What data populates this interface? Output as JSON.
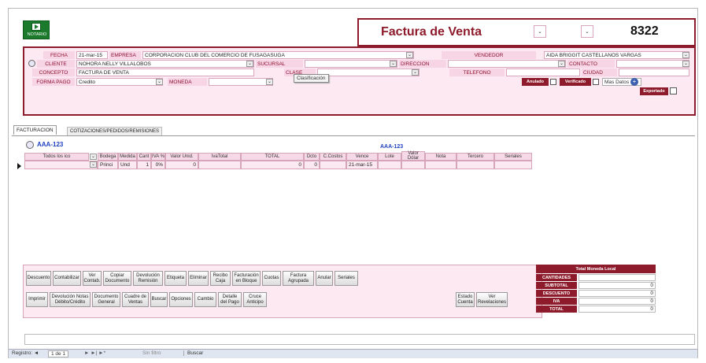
{
  "logo": {
    "label": "NOTARIO"
  },
  "header": {
    "title": "Factura de Venta",
    "number": "8322"
  },
  "fields": {
    "fecha_label": "FECHA",
    "fecha": "21-mar-15",
    "empresa_label": "EMPRESA",
    "empresa": "CORPORACION CLUB DEL COMERCIO DE FUSAGASUGA",
    "vendedor_label": "VENDEDOR",
    "vendedor": "AIDA BRIGGIT CASTELLANOS VARGAS",
    "cliente_label": "CLIENTE",
    "cliente": "NOHORA NELLY VILLALOBOS",
    "sucursal_label": "SUCURSAL",
    "direccion_label": "DIRECCION",
    "contacto_label": "CONTACTO",
    "concepto_label": "CONCEPTO",
    "concepto": "FACTURA DE VENTA",
    "clase_label": "CLASE",
    "telefono_label": "TELEFONO",
    "ciudad_label": "CIUDAD",
    "clasificacion_tooltip": "Clasificación",
    "forma_pago_label": "FORMA PAGO",
    "forma_pago": "Credito",
    "moneda_label": "MONEDA",
    "anulado_label": "Anulado",
    "verificado_label": "Verificado",
    "mas_datos_label": "Mas Datos",
    "exportado_label": "Exportado"
  },
  "tabs": [
    "FACTURACION",
    "COTIZACIONES/PEDIDOS/REMISIONES"
  ],
  "grid": {
    "title_left": "AAA-123",
    "title_right": "AAA-123",
    "columns": [
      "Todos los ico",
      "Bodega",
      "Medida",
      "Cant",
      "IVA %",
      "Valor Unid.",
      "IvaTotal",
      "TOTAL",
      "Dcto",
      "C.Costos",
      "Vence",
      "Lote",
      "Valor Dólar",
      "Nota",
      "Tercero",
      "Seriales"
    ],
    "row": {
      "bodega": "Princi",
      "medida": "Und",
      "cant": "1",
      "iva": "0%",
      "valor_unid": "0",
      "total": "0",
      "dcto": "0",
      "vence": "21-mar-15"
    }
  },
  "actions_row1": [
    "Descuento",
    "Contabilizar",
    "Ver Contab.",
    "Copiar Documento",
    "Devolución Remisión",
    "Etiqueta",
    "Eliminar",
    "Recibo Caja",
    "Facturación en Bloque",
    "Cuotas",
    "Factura Agrupada",
    "Anular",
    "Seriales"
  ],
  "actions_row2": [
    "Imprimir",
    "Devolución Notas Débito/Crédito",
    "Documento General",
    "Cuadre de Ventas",
    "Buscar",
    "Opciones",
    "Cambio",
    "Detalle del Pago",
    "Cruce Anticipo"
  ],
  "actions_right": [
    "Estado Cuenta",
    "Ver Revelaciones"
  ],
  "totals": {
    "header": "Total Moneda Local",
    "rows": [
      {
        "label": "CANTIDADES",
        "value": ""
      },
      {
        "label": "SUBTOTAL",
        "value": "0"
      },
      {
        "label": "DESCUENTO",
        "value": "0"
      },
      {
        "label": "IVA",
        "value": "0"
      },
      {
        "label": "TOTAL",
        "value": "0"
      }
    ]
  },
  "nav": {
    "registro": "Registro: ◄",
    "position": "1 de 1",
    "filter": "Sin filtro",
    "buscar": "Buscar"
  }
}
